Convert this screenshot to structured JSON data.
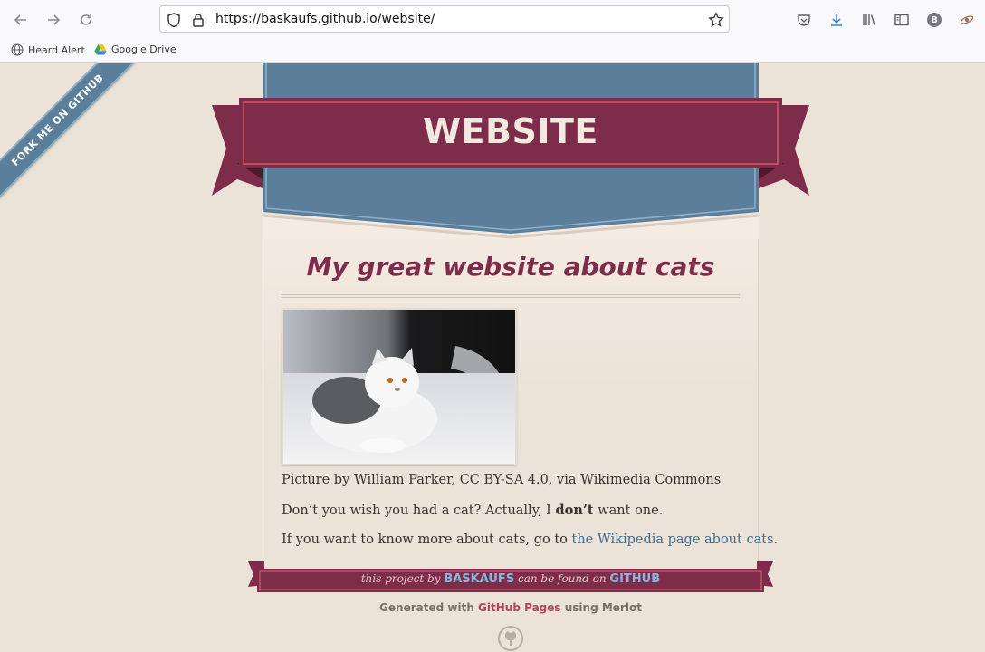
{
  "browser": {
    "url_host": "https://baskaufs.github.io",
    "url_path": "/website/",
    "profile_initial": "B",
    "bookmarks": [
      {
        "label": "Heard Alert",
        "icon": "globe-icon"
      },
      {
        "label": "Google Drive",
        "icon": "google-drive-icon"
      }
    ]
  },
  "page": {
    "fork_ribbon": "Fork me on GitHub",
    "banner_title": "WEBSITE",
    "heading": "My great website about cats",
    "image_alt": "cat photo",
    "caption": "Picture by William Parker, CC BY-SA 4.0, via Wikimedia Commons",
    "para2_before": "Don’t you wish you had a cat? Actually, I ",
    "para2_bold": "don’t",
    "para2_after": " want one.",
    "para3_before": "If you want to know more about cats, go to ",
    "para3_link": "the Wikipedia page about cats",
    "para3_after": ".",
    "footer": {
      "part1": "this project by ",
      "owner": "BASKAUFS",
      "part2": " can be found on ",
      "host": "GITHUB"
    },
    "generated": {
      "part1": "Generated with ",
      "link": "GitHub Pages",
      "part2": " using Merlot"
    }
  },
  "colors": {
    "background": "#ebe2d8",
    "maroon": "#7d2d4a",
    "blue": "#5b7f9a",
    "link": "#3d6c8f"
  }
}
